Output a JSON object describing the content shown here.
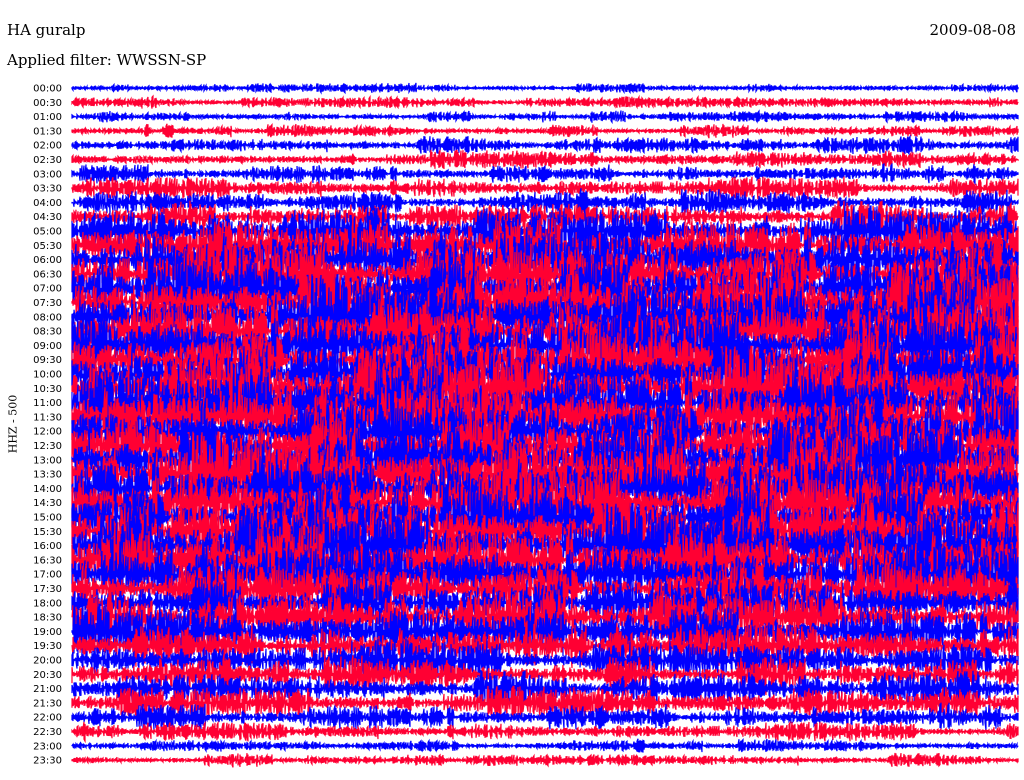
{
  "header": {
    "station": "HA guralp",
    "filter": "Applied filter: WWSSN-SP",
    "date": "2009-08-08"
  },
  "chart_data": {
    "type": "line",
    "title": "HA guralp",
    "subtitle": "Applied filter: WWSSN-SP",
    "ylabel": "HHZ - 500",
    "xlabel": "",
    "grid": false,
    "series_colors": [
      "#0000ff",
      "#ff0033"
    ],
    "row_labels": [
      "00:00",
      "00:30",
      "01:00",
      "01:30",
      "02:00",
      "02:30",
      "03:00",
      "03:30",
      "04:00",
      "04:30",
      "05:00",
      "05:30",
      "06:00",
      "06:30",
      "07:00",
      "07:30",
      "08:00",
      "08:30",
      "09:00",
      "09:30",
      "10:00",
      "10:30",
      "11:00",
      "11:30",
      "12:00",
      "12:30",
      "13:00",
      "13:30",
      "14:00",
      "14:30",
      "15:00",
      "15:30",
      "16:00",
      "16:30",
      "17:00",
      "17:30",
      "18:00",
      "18:30",
      "19:00",
      "19:30",
      "20:00",
      "20:30",
      "21:00",
      "21:30",
      "22:00",
      "22:30",
      "23:00",
      "23:30"
    ],
    "relative_amplitude": [
      0.25,
      0.3,
      0.3,
      0.35,
      0.45,
      0.45,
      0.5,
      0.6,
      0.7,
      0.8,
      1.2,
      1.5,
      1.8,
      1.9,
      2.0,
      2.0,
      2.0,
      2.0,
      2.0,
      2.0,
      2.0,
      2.0,
      2.0,
      2.0,
      2.0,
      2.0,
      2.0,
      2.0,
      2.0,
      2.0,
      2.0,
      2.0,
      2.0,
      1.9,
      1.8,
      1.6,
      1.5,
      1.4,
      1.3,
      1.2,
      1.1,
      1.0,
      0.9,
      0.8,
      0.7,
      0.5,
      0.35,
      0.35
    ]
  }
}
